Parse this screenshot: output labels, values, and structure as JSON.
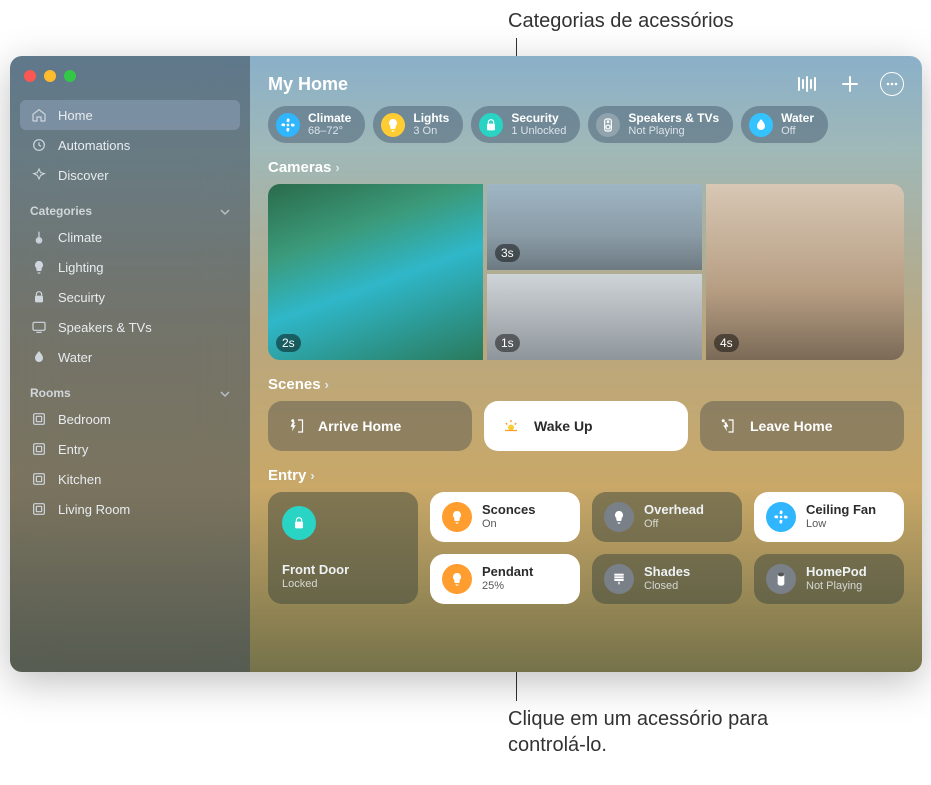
{
  "annotations": {
    "top": "Categorias de acessórios",
    "bottom": "Clique em um acessório para controlá-lo."
  },
  "header": {
    "title": "My Home",
    "intercom_icon": "intercom-icon",
    "add_icon": "plus-icon",
    "more_icon": "more-icon"
  },
  "sidebar": {
    "primary": [
      {
        "icon": "home-icon",
        "label": "Home",
        "selected": true
      },
      {
        "icon": "automations-icon",
        "label": "Automations"
      },
      {
        "icon": "discover-icon",
        "label": "Discover"
      }
    ],
    "categories_label": "Categories",
    "categories": [
      {
        "icon": "thermometer-icon",
        "label": "Climate"
      },
      {
        "icon": "bulb-icon",
        "label": "Lighting"
      },
      {
        "icon": "lock-icon",
        "label": "Secuirty"
      },
      {
        "icon": "tv-icon",
        "label": "Speakers & TVs"
      },
      {
        "icon": "droplet-icon",
        "label": "Water"
      }
    ],
    "rooms_label": "Rooms",
    "rooms": [
      {
        "label": "Bedroom"
      },
      {
        "label": "Entry"
      },
      {
        "label": "Kitchen"
      },
      {
        "label": "Living Room"
      }
    ]
  },
  "chips": [
    {
      "icon": "fan-icon",
      "color": "bg-blue",
      "title": "Climate",
      "sub": "68–72°"
    },
    {
      "icon": "bulb-icon",
      "color": "bg-yellow",
      "title": "Lights",
      "sub": "3 On"
    },
    {
      "icon": "lock-icon",
      "color": "bg-teal",
      "title": "Security",
      "sub": "1 Unlocked"
    },
    {
      "icon": "speaker-icon",
      "color": "bg-grey",
      "title": "Speakers & TVs",
      "sub": "Not Playing"
    },
    {
      "icon": "droplet-icon",
      "color": "bg-cyan",
      "title": "Water",
      "sub": "Off"
    }
  ],
  "sections": {
    "cameras_label": "Cameras",
    "scenes_label": "Scenes",
    "entry_label": "Entry"
  },
  "cameras": [
    {
      "badge": "2s",
      "style": "cam-pool",
      "big": true
    },
    {
      "badge": "3s",
      "style": "cam-street",
      "big": false
    },
    {
      "badge": "4s",
      "style": "cam-living",
      "big": true
    },
    {
      "badge": "1s",
      "style": "cam-garage",
      "big": false
    }
  ],
  "scenes": [
    {
      "icon": "arrive-icon",
      "label": "Arrive Home",
      "active": false
    },
    {
      "icon": "sunrise-icon",
      "label": "Wake Up",
      "active": true
    },
    {
      "icon": "leave-icon",
      "label": "Leave Home",
      "active": false
    }
  ],
  "entry_tiles": {
    "door": {
      "name": "Front Door",
      "status": "Locked"
    },
    "row1": [
      {
        "name": "Sconces",
        "status": "On",
        "icon": "bulb-icon",
        "ic_bg": "bg-orange",
        "bright": true
      },
      {
        "name": "Overhead",
        "status": "Off",
        "icon": "bulb-icon",
        "ic_bg": "bg-dgrey",
        "bright": false
      },
      {
        "name": "Ceiling Fan",
        "status": "Low",
        "icon": "fan-icon",
        "ic_bg": "bg-blue",
        "bright": true
      }
    ],
    "row2": [
      {
        "name": "Pendant",
        "status": "25%",
        "icon": "bulb-icon",
        "ic_bg": "bg-orange",
        "bright": true
      },
      {
        "name": "Shades",
        "status": "Closed",
        "icon": "shades-icon",
        "ic_bg": "bg-dgrey",
        "bright": false
      },
      {
        "name": "HomePod",
        "status": "Not Playing",
        "icon": "homepod-icon",
        "ic_bg": "bg-dgrey",
        "bright": false
      }
    ]
  }
}
